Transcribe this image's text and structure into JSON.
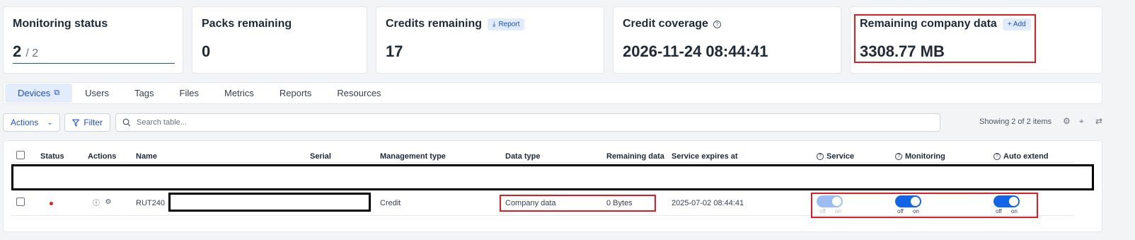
{
  "cards": {
    "monitoring": {
      "title": "Monitoring status",
      "value": "2",
      "total": "/ 2"
    },
    "packs": {
      "title": "Packs remaining",
      "value": "0"
    },
    "credits": {
      "title": "Credits remaining",
      "report_label": "Report",
      "value": "17"
    },
    "coverage": {
      "title": "Credit coverage",
      "value": "2026-11-24 08:44:41"
    },
    "company_data": {
      "title": "Remaining company data",
      "add_label": "+ Add",
      "value": "3308.77 MB"
    }
  },
  "tabs": [
    "Devices",
    "Users",
    "Tags",
    "Files",
    "Metrics",
    "Reports",
    "Resources"
  ],
  "toolbar": {
    "actions_label": "Actions",
    "filter_label": "Filter",
    "search_placeholder": "Search table...",
    "showing": "Showing 2 of 2 items"
  },
  "table": {
    "columns": [
      "Status",
      "Actions",
      "Name",
      "Serial",
      "Management type",
      "Data type",
      "Remaining data",
      "Service expires at",
      "Service",
      "Monitoring",
      "Auto extend"
    ],
    "rows": [
      {
        "status_color": "#dc2626",
        "name": "RUT240",
        "serial": "",
        "management_type": "Credit",
        "data_type": "Company data",
        "remaining_data": "0 Bytes",
        "service_expires": "2025-07-02 08:44:41",
        "service": "on",
        "monitoring": "on",
        "auto_extend": "on"
      }
    ]
  },
  "toggle_labels": {
    "off": "off",
    "on": "on"
  },
  "colors": {
    "accent": "#1464e8",
    "highlight": "#e11d23",
    "status_offline": "#dc2626"
  }
}
